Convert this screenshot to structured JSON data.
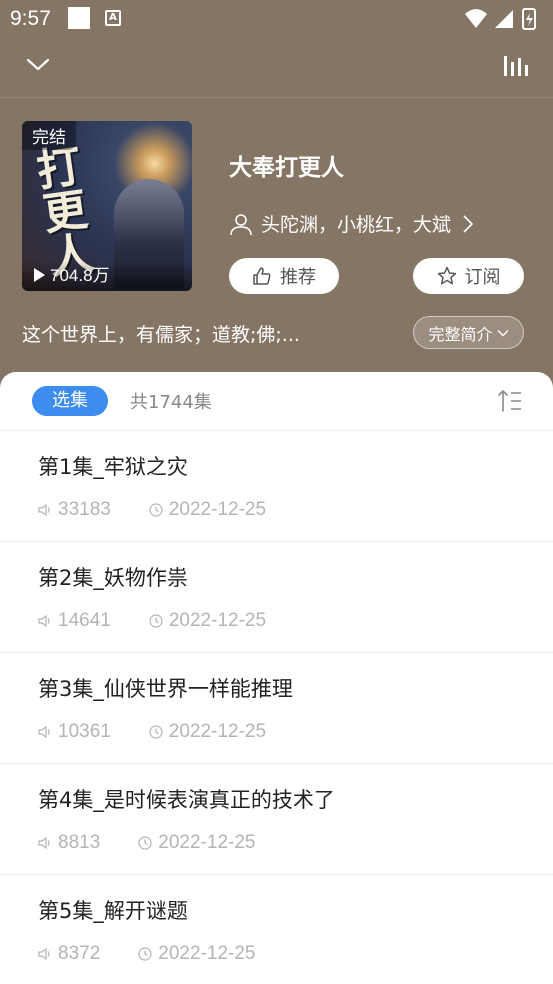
{
  "status": {
    "time": "9:57",
    "a_icon": "A"
  },
  "book": {
    "badge": "完结",
    "cover_art_text": "打更人",
    "plays": "704.8万",
    "title": "大奉打更人",
    "authors": "头陀渊，小桃红，大斌",
    "recommend_label": "推荐",
    "subscribe_label": "订阅",
    "intro": "这个世界上，有儒家；道教;佛;...",
    "intro_button": "完整简介"
  },
  "list": {
    "select_label": "选集",
    "count_label": "共1744集",
    "episodes": [
      {
        "title": "第1集_牢狱之灾",
        "plays": "33183",
        "date": "2022-12-25"
      },
      {
        "title": "第2集_妖物作祟",
        "plays": "14641",
        "date": "2022-12-25"
      },
      {
        "title": "第3集_仙侠世界一样能推理",
        "plays": "10361",
        "date": "2022-12-25"
      },
      {
        "title": "第4集_是时候表演真正的技术了",
        "plays": "8813",
        "date": "2022-12-25"
      },
      {
        "title": "第5集_解开谜题",
        "plays": "8372",
        "date": "2022-12-25"
      }
    ]
  },
  "icons": {
    "back": "chevron-down-icon",
    "stats": "bar-chart-icon",
    "user": "user-icon",
    "thumb": "thumbs-up-icon",
    "star": "star-icon",
    "sort": "sort-icon",
    "speaker": "speaker-icon",
    "clock": "clock-icon"
  },
  "colors": {
    "header_bg": "#857565",
    "accent": "#3d8cf0",
    "meta_text": "#b4b4b4"
  }
}
